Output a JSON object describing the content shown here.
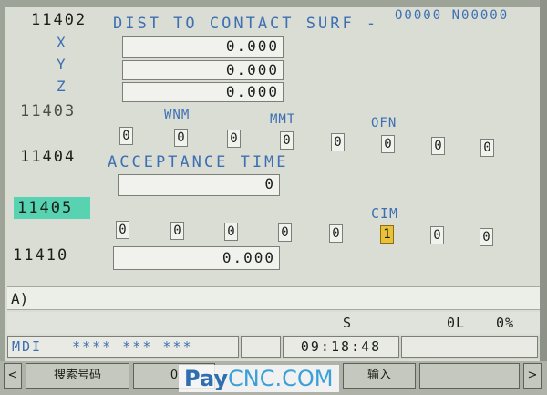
{
  "header": {
    "program_no": "O0000",
    "sequence_no": "N00000"
  },
  "params": {
    "p11402": {
      "number": "11402",
      "title": "DIST TO CONTACT SURF -",
      "axes": [
        {
          "label": "X",
          "value": "0.000"
        },
        {
          "label": "Y",
          "value": "0.000"
        },
        {
          "label": "Z",
          "value": "0.000"
        }
      ]
    },
    "p11403": {
      "number": "11403",
      "bit_labels": {
        "wnm": "WNM",
        "mmt": "MMT",
        "ofn": "OFN"
      },
      "bits": [
        "0",
        "0",
        "0",
        "0",
        "0",
        "0",
        "0",
        "0"
      ]
    },
    "p11404": {
      "number": "11404",
      "title": "ACCEPTANCE TIME",
      "value": "0"
    },
    "p11405": {
      "number": "11405",
      "bit_labels": {
        "cim": "CIM"
      },
      "bits": [
        "0",
        "0",
        "0",
        "0",
        "0",
        "1",
        "0",
        "0"
      ]
    },
    "p11410": {
      "number": "11410",
      "value": "0.000"
    }
  },
  "input_line": {
    "prompt": "A)_"
  },
  "status": {
    "spindle_label": "S",
    "spindle_value": "0L",
    "percent": "0%"
  },
  "mode_bar": {
    "mode": "MDI",
    "stars": "**** *** ***",
    "time": "09:18:48"
  },
  "softkeys": {
    "left_arrow": "<",
    "search_number": "搜索号码",
    "key2": "0",
    "input": "输入",
    "right_arrow": ">"
  },
  "watermark": {
    "part1": "Pay",
    "part2": "CNC.COM"
  }
}
